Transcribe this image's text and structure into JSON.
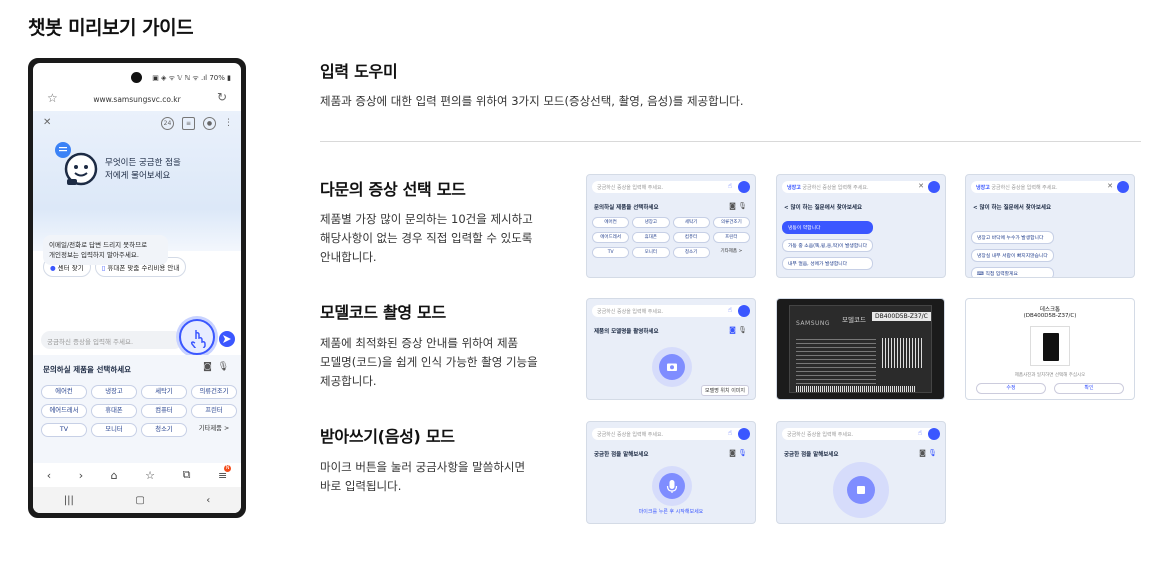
{
  "page_title": "챗봇 미리보기 가이드",
  "phone": {
    "status": "▣ ◈ ᯤ 𝕍 ℕ ᯤ .ıl 70% ▮",
    "url": "www.samsungsvc.co.kr",
    "greeting_line1": "무엇이든 궁금한 점을",
    "greeting_line2": "저에게 물어보세요",
    "chips": [
      "센터 찾기",
      "휴대폰 맞춤 수리비용 안내"
    ],
    "bubble_line1": "이메일/전화로 답변 드리지 못하므로",
    "bubble_line2": "개인정보는 입력하지 말아주세요.",
    "input_placeholder": "궁금하신 증상을 입력해 주세요.",
    "panel_title": "문의하실 제품을 선택하세요",
    "products": [
      "에어컨",
      "냉장고",
      "세탁기",
      "의류건조기",
      "에어드레서",
      "휴대폰",
      "컴퓨터",
      "프린터",
      "TV",
      "모니터",
      "청소기",
      "기타제품 >"
    ]
  },
  "sections": {
    "input_helper": {
      "title": "입력 도우미",
      "desc": "제품과 증상에 대한 입력 편의를 위하여 3가지 모드(증상선택, 촬영, 음성)를 제공합니다."
    },
    "symptom_mode": {
      "title": "다문의 증상 선택 모드",
      "desc_line1": "제품별 가장 많이 문의하는 10건을 제시하고",
      "desc_line2": "해당사항이 없는 경우 직접 입력할 수 있도록",
      "desc_line3": "안내합니다."
    },
    "model_mode": {
      "title": "모델코드 촬영 모드",
      "desc_line1": "제품에 최적화된 증상 안내를 위하여 제품",
      "desc_line2": "모델명(코드)을 쉽게 인식 가능한 촬영 기능을",
      "desc_line3": "제공합니다."
    },
    "voice_mode": {
      "title": "받아쓰기(음성) 모드",
      "desc_line1": "마이크 버튼을 눌러 궁금사항을 말씀하시면",
      "desc_line2": "바로 입력됩니다."
    }
  },
  "thumbs": {
    "input_placeholder": "궁금하신 증상을 입력해 주세요.",
    "t1_label": "문의하실 제품을 선택하세요",
    "t1_products": [
      "에어컨",
      "냉장고",
      "세탁기",
      "의류건조기",
      "에어드레서",
      "휴대폰",
      "컴퓨터",
      "프린터",
      "TV",
      "모니터",
      "청소기",
      "기타제품 >"
    ],
    "t2_prefix": "냉장고",
    "t2_title": "< 많이 하는 질문에서 찾아보세요",
    "t2_items": [
      "냉동이 약합니다",
      "가동 중 소음(뚝,윙,웅,딱)이 발생합니다",
      "내부 얼음, 성에가 발생합니다"
    ],
    "t3_items": [
      "냉장고 바닥에 누수가 발생합니다",
      "냉장실 내부 서랍이 빠지지않습니다",
      "직접 입력할게요"
    ],
    "t4_label": "제품의 모델명을 촬영하세요",
    "t4_link": "모델명 위치 이미지",
    "t5_model_label": "모델코드",
    "t5_model_code": "DB400D5B-Z37/C",
    "t5_brand": "SAMSUNG",
    "t6_title": "데스크톱",
    "t6_code": "(DB400D5B-Z37/C)",
    "t6_note": "제품사진과 일치하면 선택해 주십시오",
    "t6_btn1": "수정",
    "t6_btn2": "확인",
    "t7_label": "궁금한 점을 말해보세요",
    "t7_hint": "마이크를 누른 후 시작해보세요",
    "t8_label": "궁금한 점을 말해보세요"
  }
}
